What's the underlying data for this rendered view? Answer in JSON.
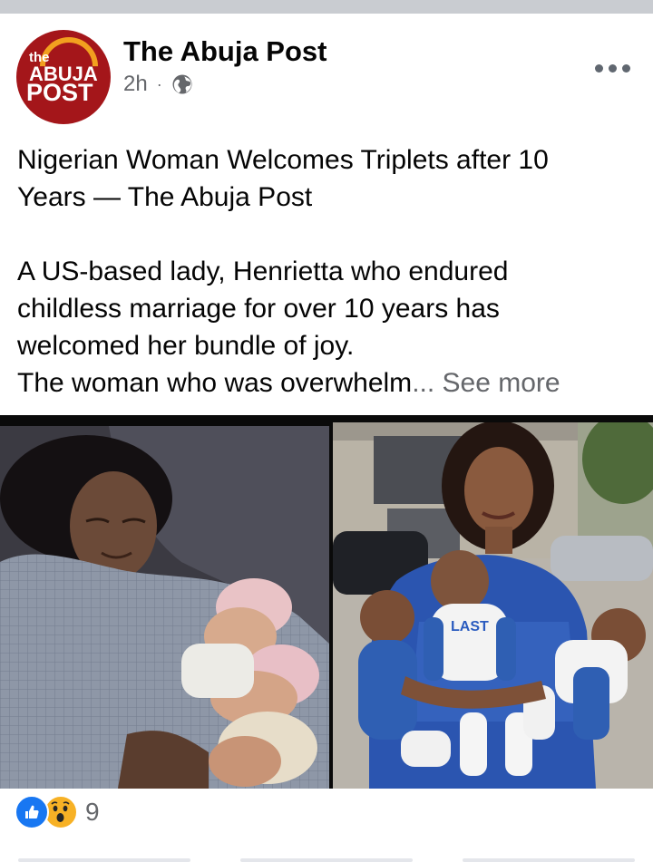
{
  "post": {
    "page_name": "The Abuja Post",
    "time": "2h",
    "audience_icon": "globe-icon",
    "avatar_logo": {
      "line1": "the",
      "line2": "ABUJA",
      "line3": "POST"
    },
    "title_line1": "Nigerian Woman Welcomes Triplets after 10",
    "title_line2": "Years — The Abuja Post",
    "body_line1": "A US-based lady, Henrietta who endured",
    "body_line2": "childless marriage for over 10 years has",
    "body_line3": "welcomed her bundle of joy.",
    "body_line4": "The woman who was overwhelm",
    "ellipsis": "...",
    "see_more": "See more",
    "photo_shirt_text": "LAST"
  },
  "reactions": {
    "icons": [
      "like-icon",
      "wow-icon"
    ],
    "count": "9"
  },
  "colors": {
    "brand_red": "#a4161a",
    "brand_orange": "#f2a01f",
    "like_blue": "#1877f2",
    "wow_yellow": "#f7b125",
    "secondary_text": "#65676b"
  }
}
